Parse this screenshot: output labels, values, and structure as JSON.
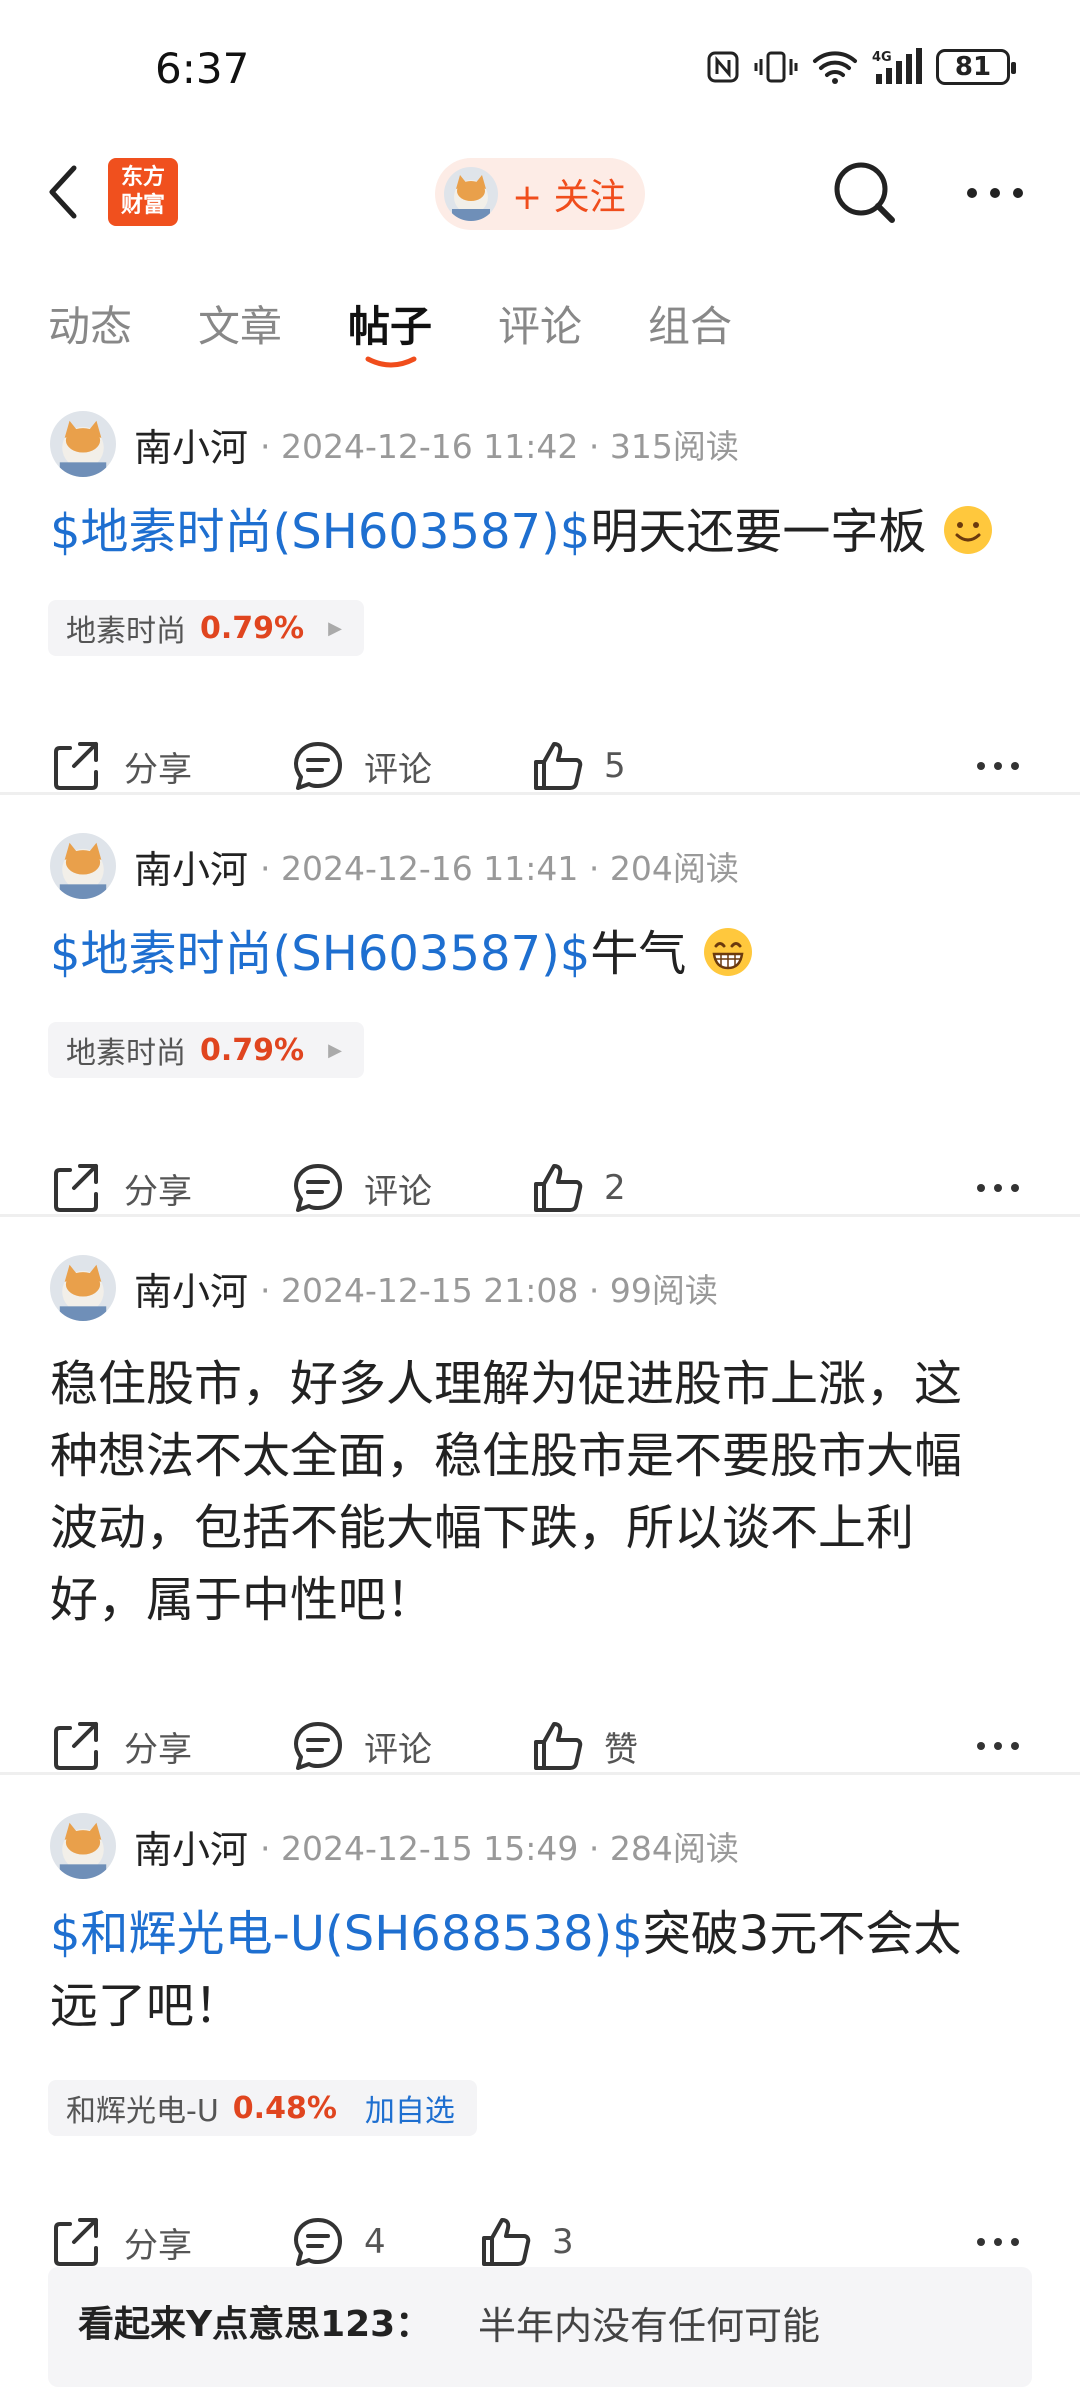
{
  "status": {
    "time": "6:37",
    "battery": "81",
    "network": "4G"
  },
  "header": {
    "logo": "东方\n财富",
    "follow_label": "+ 关注"
  },
  "tabs": [
    "动态",
    "文章",
    "帖子",
    "评论",
    "组合"
  ],
  "posts": [
    {
      "author": "南小河",
      "meta": "· 2024-12-16 11:42 · 315阅读",
      "link": "$地素时尚(SH603587)$",
      "text": "明天还要一字板",
      "emoji": "smile",
      "chip": {
        "name": "地素时尚",
        "pct": "0.79%",
        "extra": ""
      },
      "share": "分享",
      "comment": "评论",
      "like": "5"
    },
    {
      "author": "南小河",
      "meta": "· 2024-12-16 11:41 · 204阅读",
      "link": "$地素时尚(SH603587)$",
      "text": "牛气",
      "emoji": "grin",
      "chip": {
        "name": "地素时尚",
        "pct": "0.79%",
        "extra": ""
      },
      "share": "分享",
      "comment": "评论",
      "like": "2"
    },
    {
      "author": "南小河",
      "meta": "· 2024-12-15 21:08 · 99阅读",
      "body_lines": [
        "稳住股市，好多人理解为促进股市上涨，这",
        "种想法不太全面，稳住股市是不要股市大幅",
        "波动，包括不能大幅下跌，所以谈不上利",
        "好，属于中性吧！"
      ],
      "share": "分享",
      "comment": "评论",
      "like": "赞"
    },
    {
      "author": "南小河",
      "meta": "· 2024-12-15 15:49 · 284阅读",
      "link": "$和辉光电-U(SH688538)$",
      "text": "突破3元不会太",
      "text2": "远了吧！",
      "chip": {
        "name": "和辉光电-U",
        "pct": "0.48%",
        "extra": "加自选"
      },
      "share": "分享",
      "comment": "4",
      "like": "3"
    }
  ],
  "top_comment": {
    "user": "看起来Y点意思123：",
    "text": "半年内没有任何可能"
  }
}
